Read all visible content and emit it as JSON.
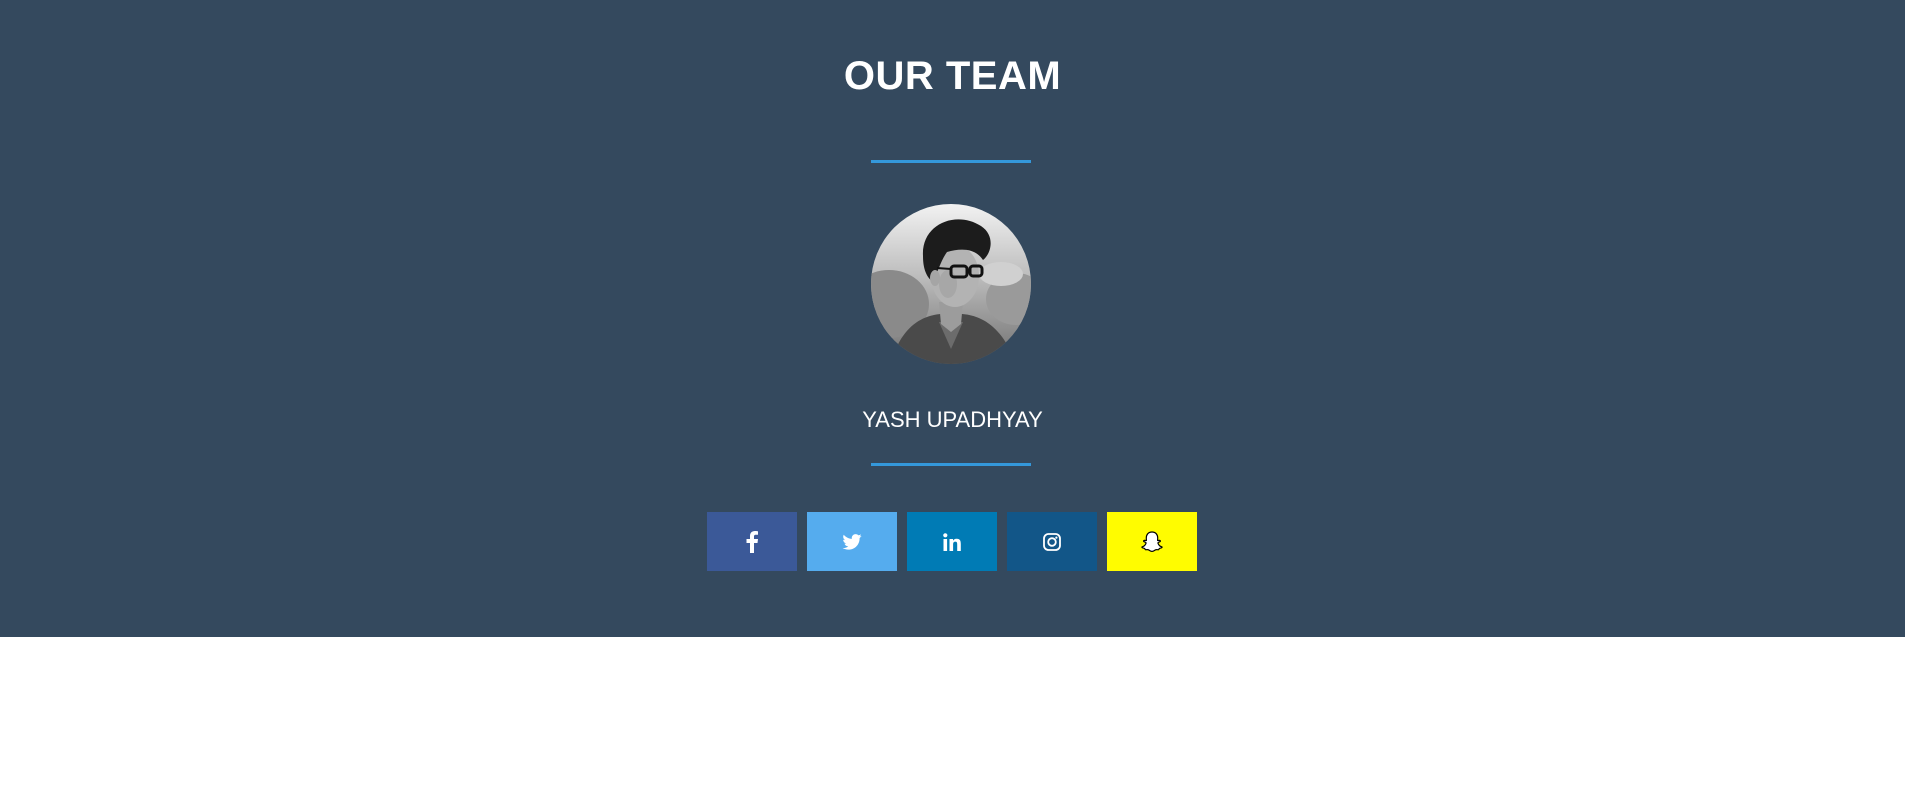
{
  "section": {
    "title": "OUR TEAM",
    "background": "#34495e",
    "accent": "#3498db"
  },
  "member": {
    "name": "YASH UPADHYAY",
    "avatar_icon": "profile-photo"
  },
  "social": [
    {
      "network": "facebook",
      "icon": "facebook-icon",
      "color": "#3b5998"
    },
    {
      "network": "twitter",
      "icon": "twitter-icon",
      "color": "#55acee"
    },
    {
      "network": "linkedin",
      "icon": "linkedin-icon",
      "color": "#007bb5"
    },
    {
      "network": "instagram",
      "icon": "instagram-icon",
      "color": "#125688"
    },
    {
      "network": "snapchat",
      "icon": "snapchat-icon",
      "color": "#fffc00"
    }
  ]
}
